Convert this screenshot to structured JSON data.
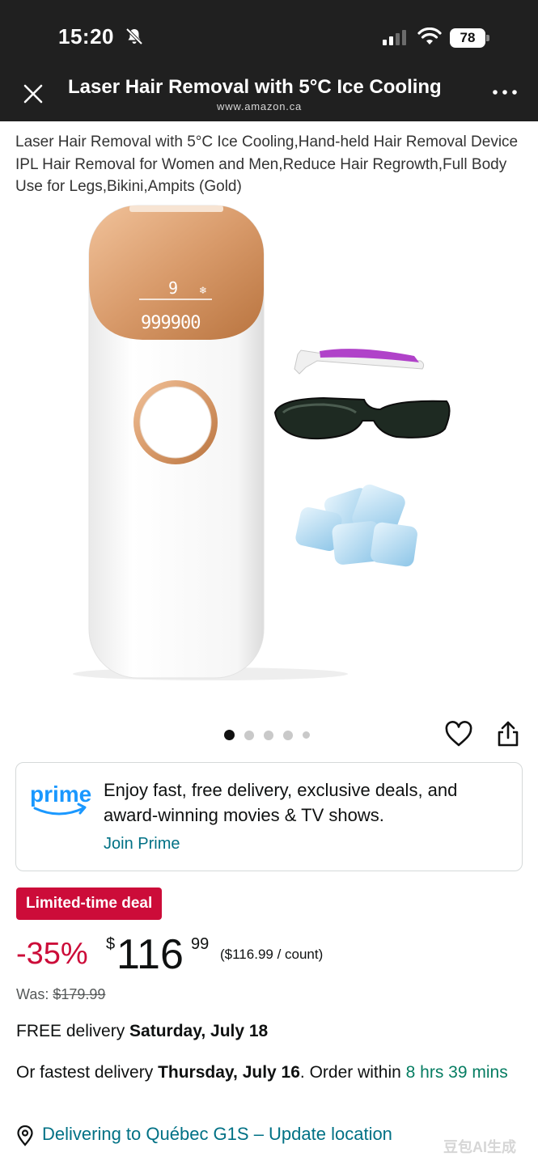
{
  "status_bar": {
    "time": "15:20",
    "battery": "78",
    "icons": [
      "bell-slash-icon",
      "cellular-signal-icon",
      "wifi-icon",
      "battery-icon"
    ]
  },
  "nav": {
    "title": "Laser Hair Removal with 5°C Ice Cooling",
    "url": "www.amazon.ca",
    "close_icon": "close-icon",
    "more_icon": "more-icon"
  },
  "product": {
    "title": "Laser Hair Removal with 5°C Ice Cooling,Hand-held Hair Removal Device IPL Hair Removal for Women and Men,Reduce Hair Regrowth,Full Body Use for Legs,Bikini,Ampits (Gold)",
    "device_display": {
      "level": "9",
      "count": "999900"
    },
    "gallery": {
      "image_count": 5,
      "active_index": 0
    }
  },
  "prime": {
    "logo_text": "prime",
    "message": "Enjoy fast, free delivery, exclusive deals, and award-winning movies & TV shows.",
    "link": "Join Prime"
  },
  "pricing": {
    "deal_badge": "Limited-time deal",
    "discount": "-35%",
    "currency": "$",
    "whole": "116",
    "fraction": "99",
    "unit_price": "($116.99 / count)",
    "was_label": "Was:",
    "was_price": "$179.99"
  },
  "delivery": {
    "free_prefix": "FREE delivery ",
    "free_date": "Saturday, July 18",
    "fast_prefix": "Or fastest delivery ",
    "fast_date": "Thursday, July 16",
    "order_within": ". Order within ",
    "countdown": "8 hrs 39 mins"
  },
  "location": {
    "text": "Delivering to Québec G1S – Update location"
  },
  "watermark": "豆包AI生成",
  "colors": {
    "deal_red": "#cc0c39",
    "link_teal": "#007185",
    "countdown_green": "#067d62",
    "header_bg": "#202020",
    "device_gold": "#d89a6a"
  }
}
